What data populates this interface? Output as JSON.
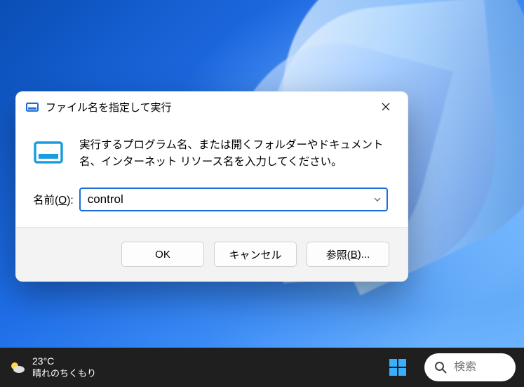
{
  "dialog": {
    "title": "ファイル名を指定して実行",
    "description": "実行するプログラム名、または開くフォルダーやドキュメント名、インターネット リソース名を入力してください。",
    "name_label_prefix": "名前(",
    "name_label_accel": "O",
    "name_label_suffix": "):",
    "input_value": "control",
    "buttons": {
      "ok": "OK",
      "cancel": "キャンセル",
      "browse_prefix": "参照(",
      "browse_accel": "B",
      "browse_suffix": ")..."
    }
  },
  "taskbar": {
    "temperature": "23°C",
    "condition": "晴れのちくもり",
    "search_placeholder": "検索"
  }
}
